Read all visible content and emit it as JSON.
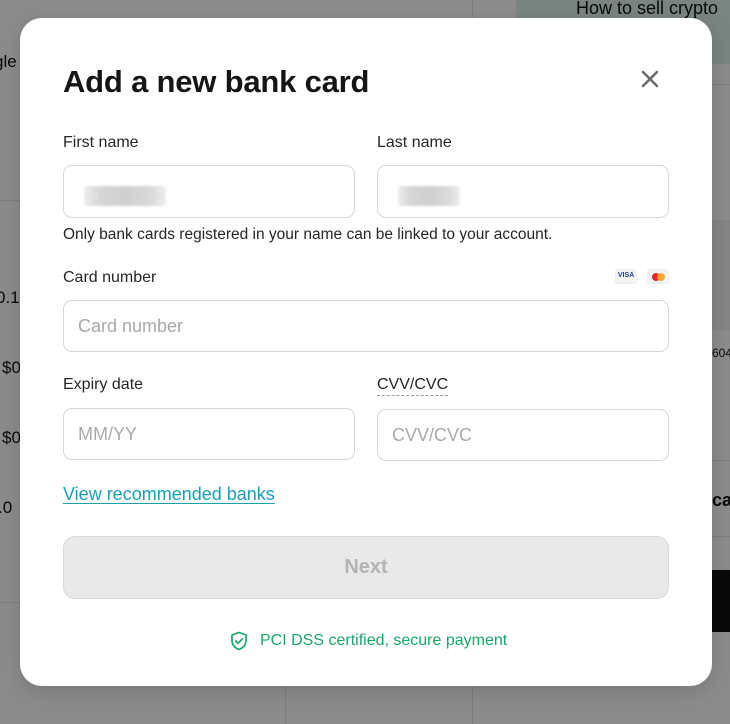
{
  "background": {
    "promo_text": "How to sell crypto",
    "fragments": [
      "gle",
      "0.1",
      "$0",
      "$0",
      ".0",
      "604",
      "car"
    ]
  },
  "modal": {
    "title": "Add a new bank card",
    "close_icon": "close-icon",
    "first_name": {
      "label": "First name",
      "value": ""
    },
    "last_name": {
      "label": "Last name",
      "value": ""
    },
    "name_hint": "Only bank cards registered in your name can be linked to your account.",
    "card_number": {
      "label": "Card number",
      "placeholder": "Card number",
      "value": ""
    },
    "card_brands": [
      "VISA",
      "mastercard-icon"
    ],
    "expiry": {
      "label": "Expiry date",
      "placeholder": "MM/YY",
      "value": ""
    },
    "cvv": {
      "label": "CVV/CVC",
      "placeholder": "CVV/CVC",
      "value": ""
    },
    "recommended_link": "View recommended banks",
    "next_label": "Next",
    "secure_text": "PCI DSS certified, secure payment",
    "secure_icon": "shield-check-icon"
  },
  "colors": {
    "accent_link": "#1aa0b6",
    "secure_green": "#17a86b",
    "disabled_button": "#e9e9e9"
  }
}
